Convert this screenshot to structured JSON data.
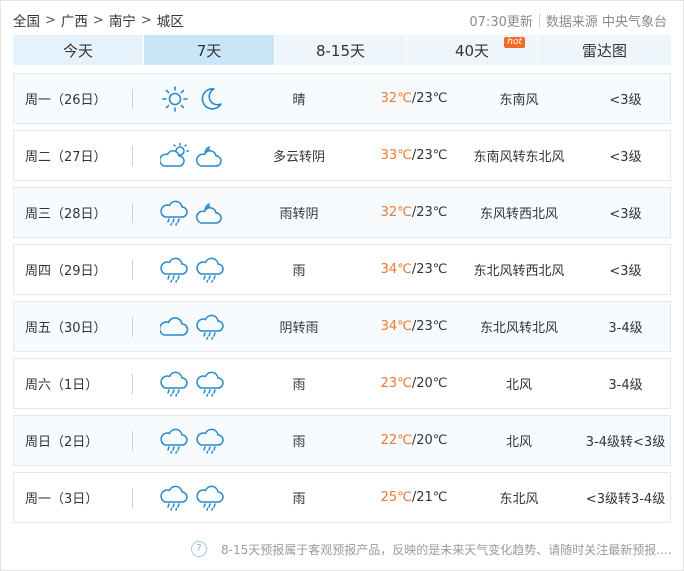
{
  "breadcrumb": {
    "items": [
      "全国",
      "广西",
      "南宁",
      "城区"
    ],
    "separator": ">"
  },
  "update": {
    "time": "07:30更新",
    "source": "数据来源 中央气象台"
  },
  "tabs": [
    {
      "label": "今天"
    },
    {
      "label": "7天",
      "active": true
    },
    {
      "label": "8-15天"
    },
    {
      "label": "40天",
      "badge": "hot"
    },
    {
      "label": "雷达图"
    }
  ],
  "forecast": [
    {
      "date": "周一（26日）",
      "icons": [
        "sun-icon",
        "moon-icon"
      ],
      "desc": "晴",
      "high": "32℃",
      "low": "/23℃",
      "wind": "东南风",
      "level": "<3级"
    },
    {
      "date": "周二（27日）",
      "icons": [
        "partly-cloudy-day-icon",
        "partly-cloudy-night-icon"
      ],
      "desc": "多云转阴",
      "high": "33℃",
      "low": "/23℃",
      "wind": "东南风转东北风",
      "level": "<3级"
    },
    {
      "date": "周三（28日）",
      "icons": [
        "rain-icon",
        "partly-cloudy-night-icon"
      ],
      "desc": "雨转阴",
      "high": "32℃",
      "low": "/23℃",
      "wind": "东风转西北风",
      "level": "<3级"
    },
    {
      "date": "周四（29日）",
      "icons": [
        "rain-icon",
        "rain-icon"
      ],
      "desc": "雨",
      "high": "34℃",
      "low": "/23℃",
      "wind": "东北风转西北风",
      "level": "<3级"
    },
    {
      "date": "周五（30日）",
      "icons": [
        "cloud-icon",
        "rain-icon"
      ],
      "desc": "阴转雨",
      "high": "34℃",
      "low": "/23℃",
      "wind": "东北风转北风",
      "level": "3-4级"
    },
    {
      "date": "周六（1日）",
      "icons": [
        "rain-icon",
        "rain-icon"
      ],
      "desc": "雨",
      "high": "23℃",
      "low": "/20℃",
      "wind": "北风",
      "level": "3-4级"
    },
    {
      "date": "周日（2日）",
      "icons": [
        "rain-icon",
        "rain-icon"
      ],
      "desc": "雨",
      "high": "22℃",
      "low": "/20℃",
      "wind": "北风",
      "level": "3-4级转<3级"
    },
    {
      "date": "周一（3日）",
      "icons": [
        "rain-icon",
        "rain-icon"
      ],
      "desc": "雨",
      "high": "25℃",
      "low": "/21℃",
      "wind": "东北风",
      "level": "<3级转3-4级"
    }
  ],
  "footer": {
    "help_glyph": "?",
    "note": "8-15天预报属于客观预报产品，反映的是未来天气变化趋势、请随时关注最新预报......"
  },
  "colors": {
    "accent": "#c9e6f8",
    "high_temp": "#f0782e",
    "icon_stroke": "#2a8bc8"
  }
}
